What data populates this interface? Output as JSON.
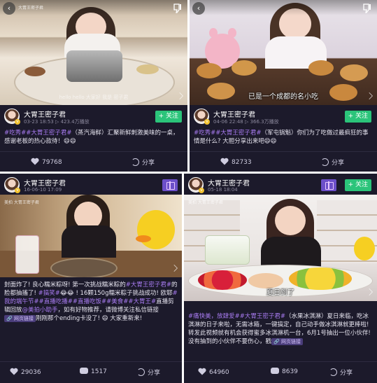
{
  "cards": [
    {
      "watermark": "大胃王密子君",
      "caption": "hello hello 大家好 我是 密子君",
      "user": "大胃王密子君",
      "meta": "03-23 18:53  ▷ 423.4万播放",
      "follow_label": "+ 关注",
      "desc_tags": "#吃秀##大胃王密子君#",
      "desc_text": "（蒸汽海鲜）汇聚新鲜刺激美味的一桌，感谢老板的热心款待！😄😄",
      "likes": "79768",
      "share_label": "分享"
    },
    {
      "subtitle": "已是一个成都的名小吃",
      "user": "大胃王密子君",
      "meta": "04-06 22:48  ▷ 366.3万播放",
      "follow_label": "+ 关注",
      "desc_tags": "#吃秀##大胃王密子君#",
      "desc_text": "（军屯锅魁）你们为了吃做过最疯狂的事情是什么? 大胆分享出来吧😄😄",
      "likes": "82733",
      "share_label": "分享"
    },
    {
      "watermark": "美拍 大胃王密子君",
      "user": "大胃王密子君",
      "meta": "16-06-10 17:09",
      "desc_p1": "封面炸了! 良心糯米粽呀! 第一次挑战糯米粽的",
      "desc_tag1": "#大胃王密子君#",
      "desc_p2": "的脸都抽搐了! ",
      "desc_tag2": "#搞笑#",
      "desc_p3": "😂😂 ! 16颗150g糯米粽子挑战成功! 欧耶",
      "desc_tag3": "#我的端午节##直播吃播##直播吃饭##美食#",
      "desc_tag4": "#大胃王#",
      "desc_p4": "直播剪辑回放",
      "desc_tag5": "@美拍小助手",
      "desc_p5": "，如有好物推荐，请微博关注私信链接",
      "link_label": "🔗 网页链接",
      "desc_p6": "刚刚那个ending卡没了! 😄 大家重新来!",
      "likes": "29036",
      "comments": "1517",
      "share_label": "分享"
    },
    {
      "watermark": "美拍 大胃王密子君",
      "subtitle": "夏日到了",
      "user": "大胃王密子君",
      "meta": "05-18 18:04",
      "follow_label": "+ 关注",
      "desc_tags": "#痛快美，放肆爱##大胃王密子君#",
      "desc_text": "（水果冰淇淋）夏日来临，吃冰淇淋的日子来啦，无需冰箱，一键搞定，自己动手做冰淇淋就更棒啦! 转发此视频就有机会获得蜜多冰淇淋机一台，6月1号抽出一位小伙伴! 没有抽到的小伙伴不要伤心，戳",
      "link_label": "🔗 网页链接",
      "likes": "64960",
      "comments": "8639",
      "share_label": "分享"
    }
  ]
}
